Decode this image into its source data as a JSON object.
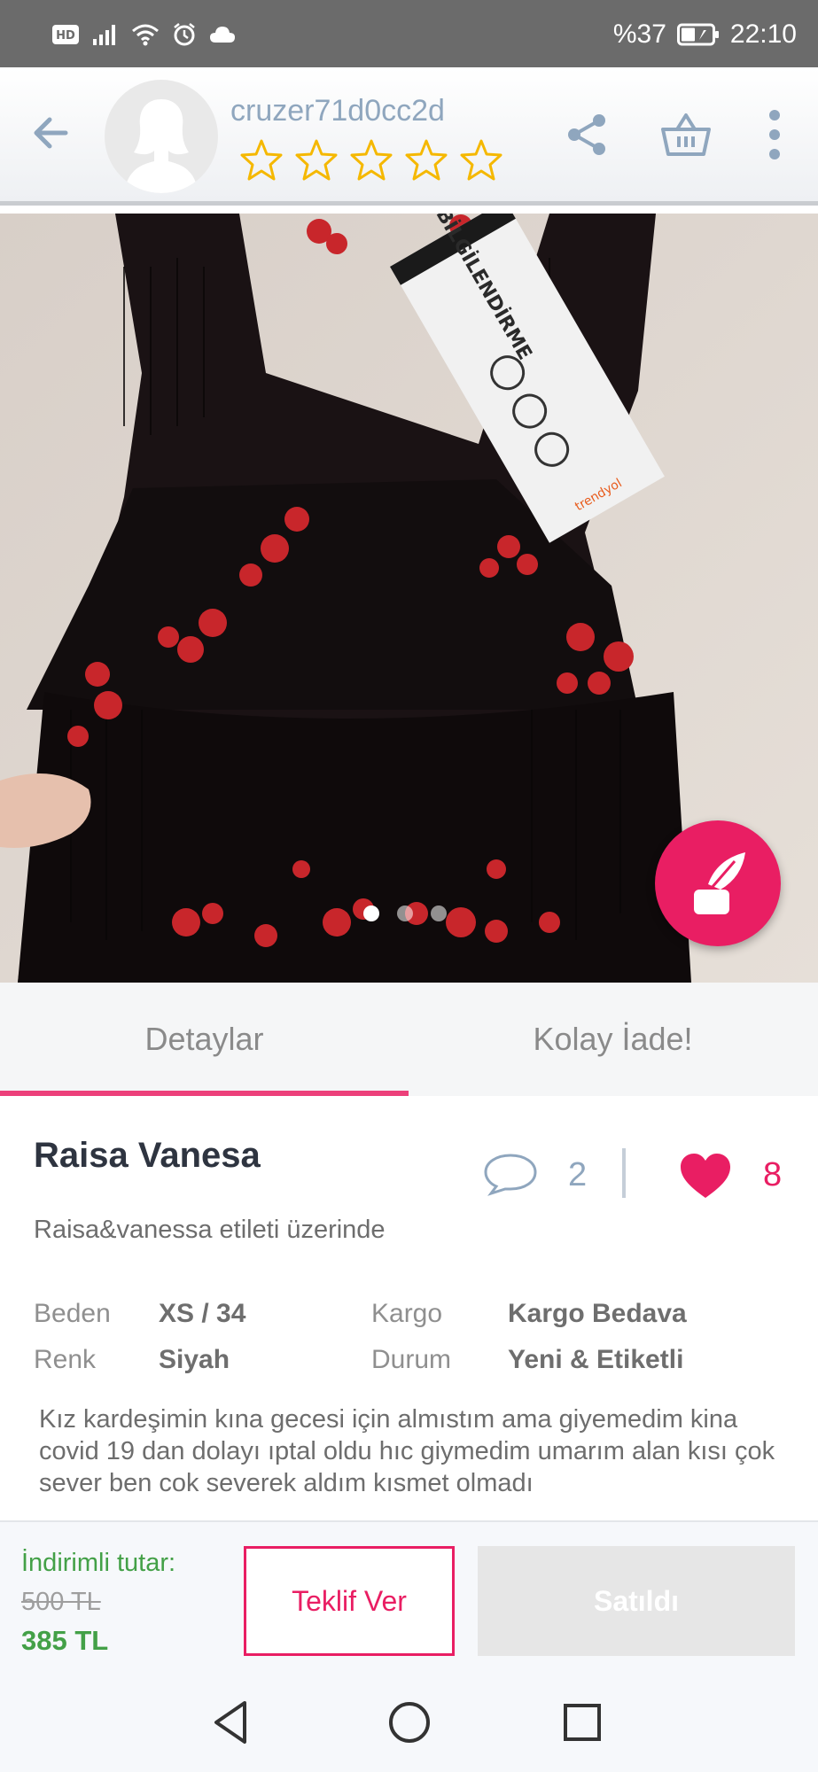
{
  "status_bar": {
    "hd_badge": "HD",
    "battery_percent": "%37",
    "time": "22:10",
    "icons": [
      "hd-icon",
      "signal-icon",
      "wifi-icon",
      "alarm-icon",
      "cloud-icon",
      "battery-icon"
    ]
  },
  "header": {
    "username": "cruzer71d0cc2d",
    "rating_stars": 5,
    "star_color": "#f5b800",
    "icons": [
      "back-arrow-icon",
      "avatar-placeholder-icon",
      "share-icon",
      "basket-icon",
      "more-vertical-icon"
    ]
  },
  "photo": {
    "tag_text": "BİLGİLENDİRME",
    "tag_brand": "trendyol",
    "slide_count": 3,
    "active_slide": 1
  },
  "fab": {
    "icon": "quill-pen-icon",
    "color": "#e91e63"
  },
  "tabs": [
    {
      "label": "Detaylar",
      "active": true
    },
    {
      "label": "Kolay İade!",
      "active": false
    }
  ],
  "product": {
    "title": "Raisa Vanesa",
    "subtitle": "Raisa&vanessa etileti üzerinde",
    "comment_count": "2",
    "like_count": "8",
    "attributes": [
      {
        "label": "Beden",
        "value": "XS / 34"
      },
      {
        "label": "Kargo",
        "value": "Kargo Bedava"
      },
      {
        "label": "Renk",
        "value": "Siyah"
      },
      {
        "label": "Durum",
        "value": "Yeni & Etiketli"
      }
    ],
    "description": "Kız kardeşimin kına gecesi için almıstım ama giyemedim kina covid 19 dan dolayı ıptal oldu hıc giymedim umarım alan kısı çok sever ben cok severek aldım kısmet olmadı"
  },
  "purchase": {
    "discount_label": "İndirimli tutar:",
    "old_price": "500 TL",
    "new_price": "385 TL",
    "offer_button": "Teklif Ver",
    "sold_button": "Satıldı"
  },
  "colors": {
    "accent": "#e91e63",
    "price_green": "#43a047",
    "muted_blue": "#8fa6be"
  },
  "nav": [
    "nav-back-icon",
    "nav-home-icon",
    "nav-recents-icon"
  ]
}
